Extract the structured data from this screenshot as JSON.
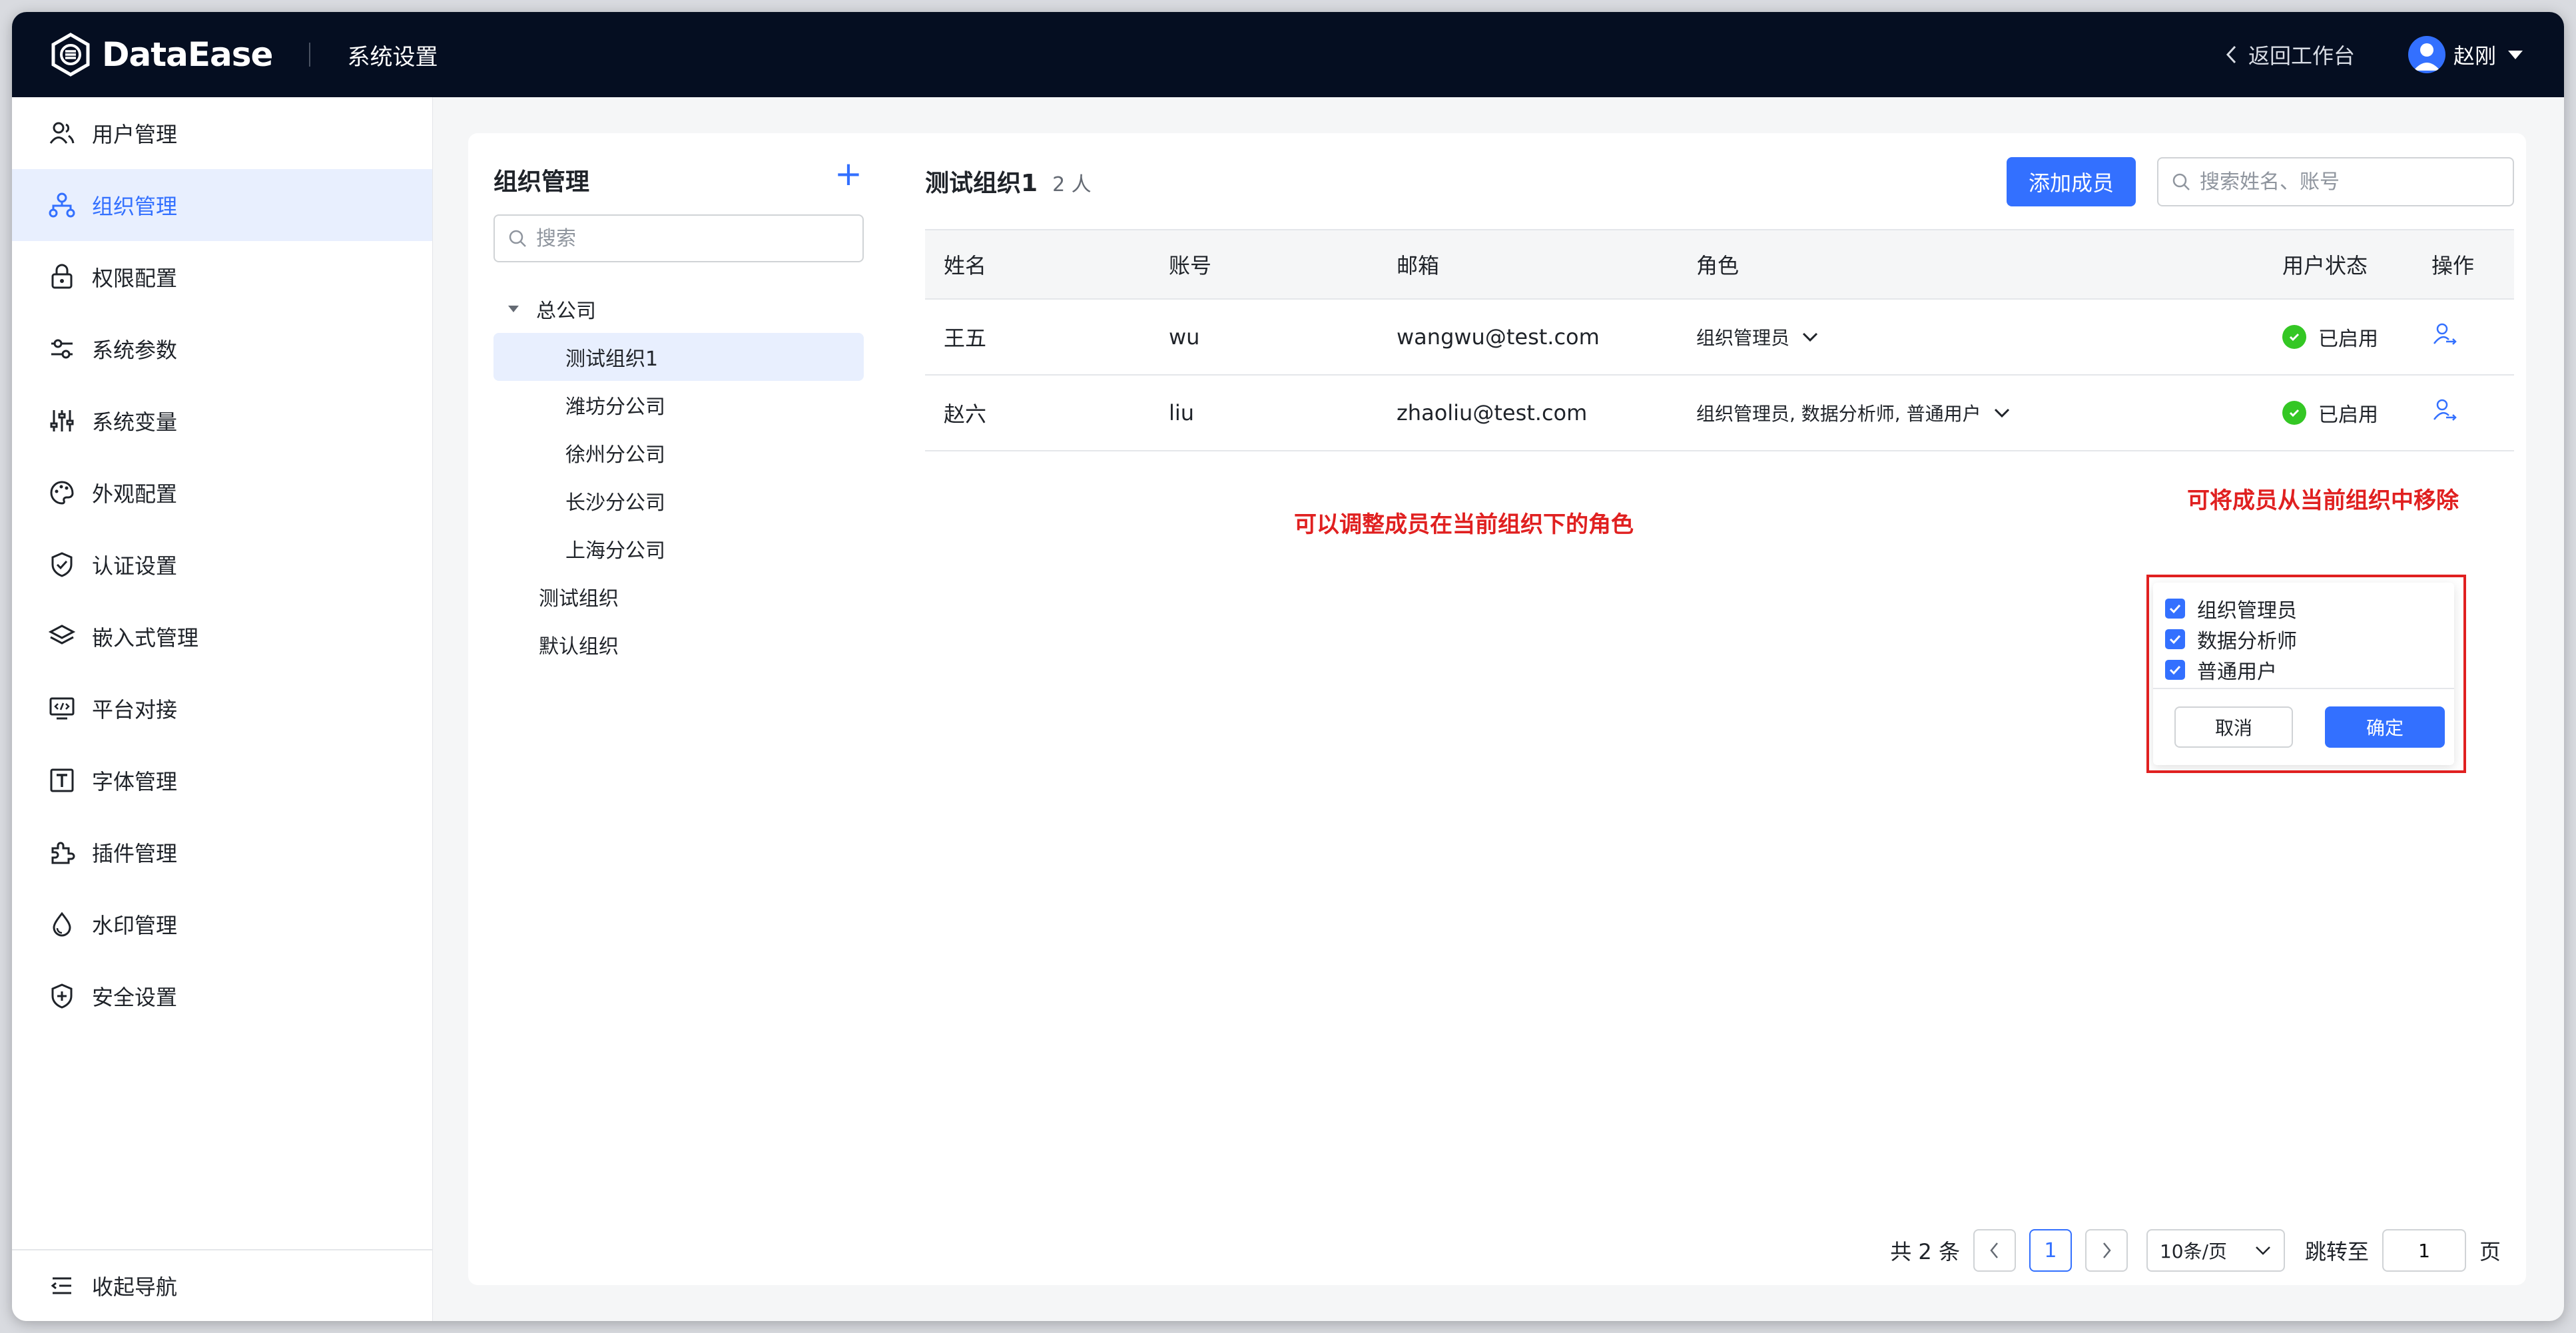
{
  "header": {
    "brand": "DataEase",
    "section_title": "系统设置",
    "back_label": "返回工作台",
    "user_name": "赵刚"
  },
  "sidebar": {
    "items": [
      {
        "label": "用户管理",
        "icon": "users-icon"
      },
      {
        "label": "组织管理",
        "icon": "org-tree-icon",
        "active": true
      },
      {
        "label": "权限配置",
        "icon": "lock-icon"
      },
      {
        "label": "系统参数",
        "icon": "sliders-icon"
      },
      {
        "label": "系统变量",
        "icon": "variables-icon"
      },
      {
        "label": "外观配置",
        "icon": "palette-icon"
      },
      {
        "label": "认证设置",
        "icon": "shield-check-icon"
      },
      {
        "label": "嵌入式管理",
        "icon": "layers-icon"
      },
      {
        "label": "平台对接",
        "icon": "monitor-code-icon"
      },
      {
        "label": "字体管理",
        "icon": "font-icon"
      },
      {
        "label": "插件管理",
        "icon": "puzzle-icon"
      },
      {
        "label": "水印管理",
        "icon": "droplet-icon"
      },
      {
        "label": "安全设置",
        "icon": "shield-plus-icon"
      }
    ],
    "collapse_label": "收起导航"
  },
  "org": {
    "title": "组织管理",
    "search_placeholder": "搜索",
    "tree": {
      "root": "总公司",
      "children": [
        "测试组织1",
        "潍坊分公司",
        "徐州分公司",
        "长沙分公司",
        "上海分公司"
      ],
      "siblings": [
        "测试组织",
        "默认组织"
      ]
    }
  },
  "members": {
    "title": "测试组织1",
    "count": "2 人",
    "add_label": "添加成员",
    "search_placeholder": "搜索姓名、账号",
    "columns": [
      "姓名",
      "账号",
      "邮箱",
      "角色",
      "用户状态",
      "操作"
    ],
    "rows": [
      {
        "name": "王五",
        "account": "wu",
        "email": "wangwu@test.com",
        "role": "组织管理员",
        "status": "已启用"
      },
      {
        "name": "赵六",
        "account": "liu",
        "email": "zhaoliu@test.com",
        "role": "组织管理员, 数据分析师, 普通用户",
        "status": "已启用"
      }
    ]
  },
  "role_popover": {
    "options": [
      "组织管理员",
      "数据分析师",
      "普通用户"
    ],
    "cancel_label": "取消",
    "ok_label": "确定"
  },
  "annotations": {
    "role_note": "可以调整成员在当前组织下的角色",
    "remove_note": "可将成员从当前组织中移除"
  },
  "pagination": {
    "total": "共 2 条",
    "current_page": "1",
    "page_size": "10条/页",
    "jump_label": "跳转至",
    "jump_value": "1",
    "unit": "页"
  },
  "colors": {
    "accent": "#3370ff",
    "header_bg": "#050e21",
    "annotation": "#e02020",
    "status_ok": "#34c724"
  }
}
